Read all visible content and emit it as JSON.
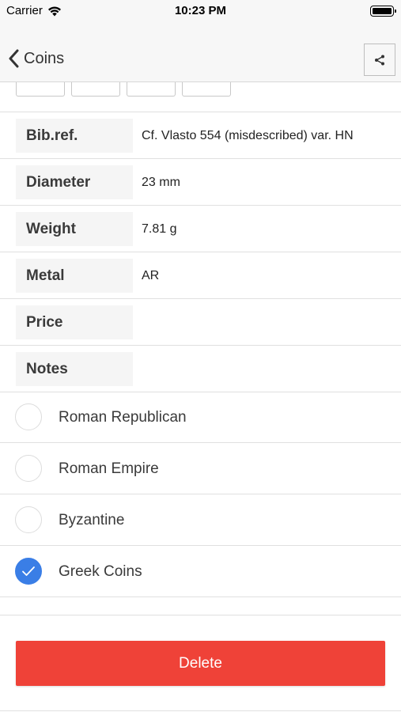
{
  "status_bar": {
    "carrier": "Carrier",
    "time": "10:23 PM"
  },
  "nav": {
    "back_label": "Coins",
    "back_icon": "chevron-left-icon",
    "share_icon": "share-icon"
  },
  "fields": [
    {
      "label": "Bib.ref.",
      "value": "Cf. Vlasto 554 (misdescribed) var. HN"
    },
    {
      "label": "Diameter",
      "value": "23 mm"
    },
    {
      "label": "Weight",
      "value": "7.81 g"
    },
    {
      "label": "Metal",
      "value": "AR"
    },
    {
      "label": "Price",
      "value": ""
    },
    {
      "label": "Notes",
      "value": ""
    }
  ],
  "categories": [
    {
      "label": "Roman Republican",
      "checked": false
    },
    {
      "label": "Roman Empire",
      "checked": false
    },
    {
      "label": "Byzantine",
      "checked": false
    },
    {
      "label": "Greek Coins",
      "checked": true
    }
  ],
  "delete_label": "Delete",
  "colors": {
    "accent": "#3a7ee6",
    "danger": "#ef4238"
  }
}
